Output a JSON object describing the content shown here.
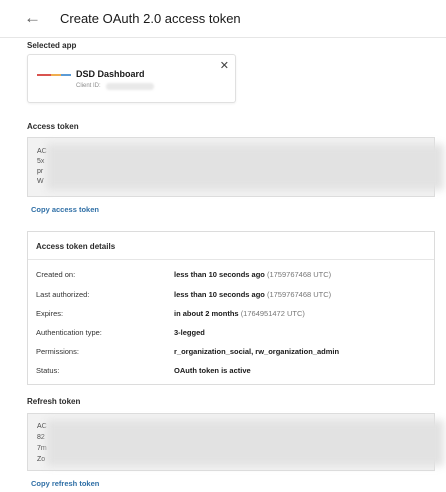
{
  "header": {
    "back_icon": "arrow-left-icon",
    "title": "Create OAuth 2.0 access token"
  },
  "selected_app": {
    "label": "Selected app",
    "app_name": "DSD Dashboard",
    "client_id_label": "Client ID:",
    "close_icon": "close-icon"
  },
  "access_token": {
    "label": "Access token",
    "prefixes": [
      "AC",
      "5x",
      "pr",
      "W"
    ],
    "copy_label": "Copy access token"
  },
  "details": {
    "title": "Access token details",
    "rows": [
      {
        "key": "Created on:",
        "value": "less than 10 seconds ago",
        "extra": "(1759767468 UTC)"
      },
      {
        "key": "Last authorized:",
        "value": "less than 10 seconds ago",
        "extra": "(1759767468 UTC)"
      },
      {
        "key": "Expires:",
        "value": "in about 2 months",
        "extra": "(1764951472 UTC)"
      },
      {
        "key": "Authentication type:",
        "value": "3-legged",
        "extra": ""
      },
      {
        "key": "Permissions:",
        "value": "r_organization_social, rw_organization_admin",
        "extra": ""
      },
      {
        "key": "Status:",
        "value": "OAuth token is active",
        "extra": ""
      }
    ]
  },
  "refresh_token": {
    "label": "Refresh token",
    "prefixes": [
      "AC",
      "82",
      "7m",
      "Zo"
    ],
    "copy_label": "Copy refresh token"
  },
  "colors": {
    "link": "#2f6fa6",
    "box_bg": "#f2f2f2",
    "border": "#dcdcdc"
  }
}
